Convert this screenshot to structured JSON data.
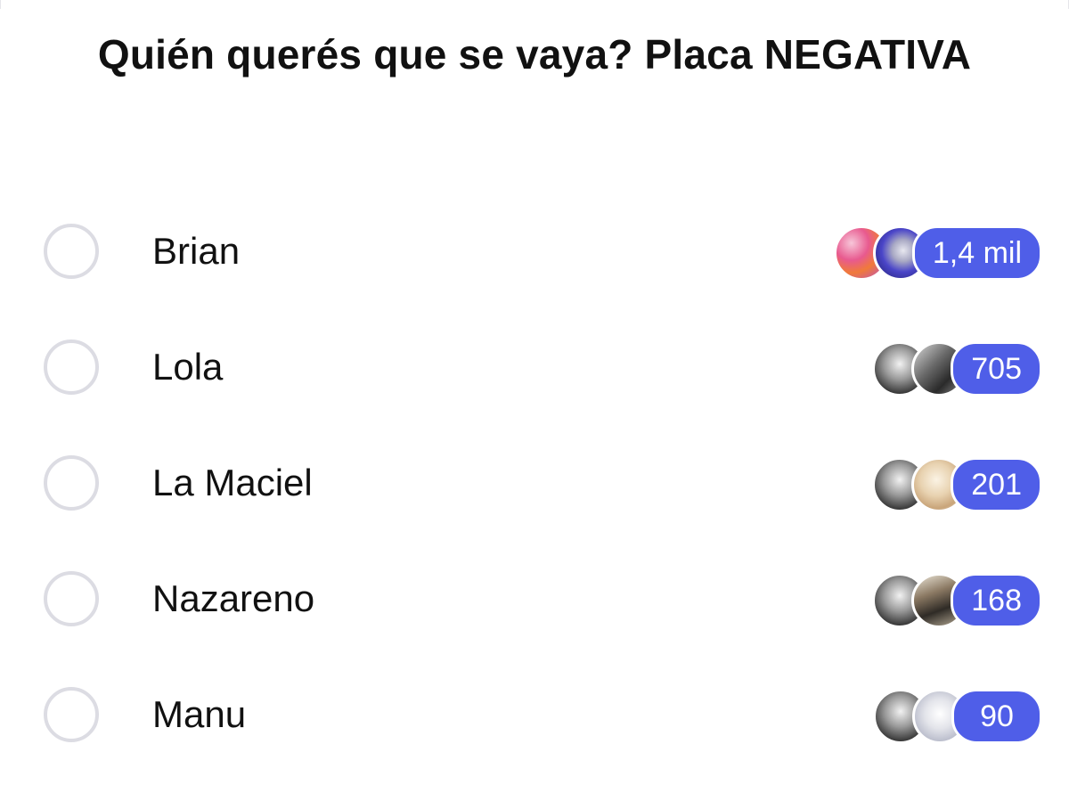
{
  "poll": {
    "title": "Quién querés que se vaya? Placa NEGATIVA",
    "accent_color": "#4f5ee8",
    "options": [
      {
        "label": "Brian",
        "count": "1,4 mil",
        "avatars": [
          "colorful-avatar",
          "purple-avatar"
        ]
      },
      {
        "label": "Lola",
        "count": "705",
        "avatars": [
          "bw-avatar",
          "bw-avatar"
        ]
      },
      {
        "label": "La Maciel",
        "count": "201",
        "avatars": [
          "bw-avatar",
          "beige-avatar"
        ]
      },
      {
        "label": "Nazareno",
        "count": "168",
        "avatars": [
          "bw-avatar",
          "cafe-avatar"
        ]
      },
      {
        "label": "Manu",
        "count": "90",
        "avatars": [
          "bw-avatar",
          "pale-avatar"
        ]
      }
    ]
  }
}
